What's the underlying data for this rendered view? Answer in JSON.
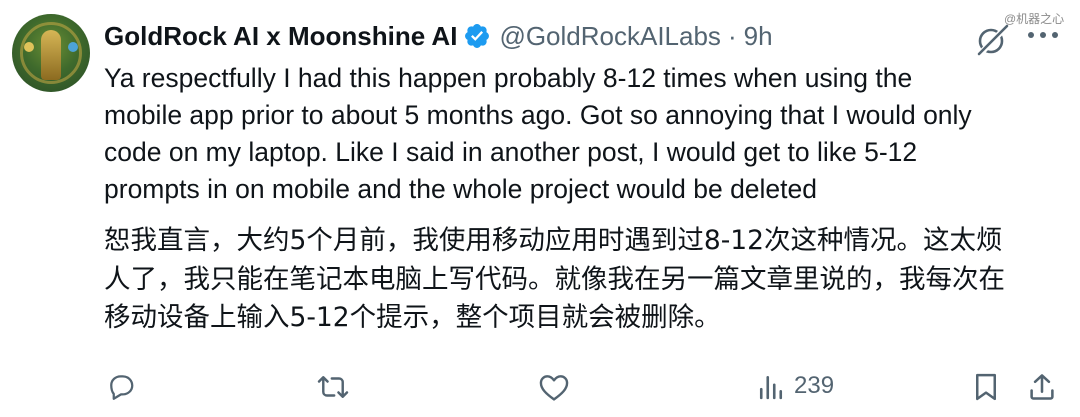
{
  "author": {
    "display_name": "GoldRock AI x Moonshine AI",
    "handle": "@GoldRockAILabs",
    "separator": "·",
    "time": "9h",
    "verified_badge_color": "#1d9bf0"
  },
  "watermark": "@机器之心",
  "body": {
    "english_lines": [
      "Ya respectfully I had this happen probably 8-12 times when using the",
      "mobile app prior to about 5 months ago. Got so annoying that I would only",
      "code on my laptop. Like I said in another post, I would get to like 5-12",
      "prompts in on mobile and the whole project would be deleted"
    ],
    "chinese_lines": [
      "恕我直言，大约5个月前，我使用移动应用时遇到过8-12次这种情况。这太烦",
      "人了，我只能在笔记本电脑上写代码。就像我在另一篇文章里说的，我每次在",
      "移动设备上输入5-12个提示，整个项目就会被删除。"
    ]
  },
  "actions": {
    "reply_icon": "reply-icon",
    "repost_icon": "repost-icon",
    "like_icon": "heart-icon",
    "views_icon": "analytics-icon",
    "views_count": "239",
    "bookmark_icon": "bookmark-icon",
    "share_icon": "share-icon",
    "icon_color": "#536471"
  },
  "top_right": {
    "grok_icon": "grok-icon",
    "more_icon": "more-icon"
  }
}
